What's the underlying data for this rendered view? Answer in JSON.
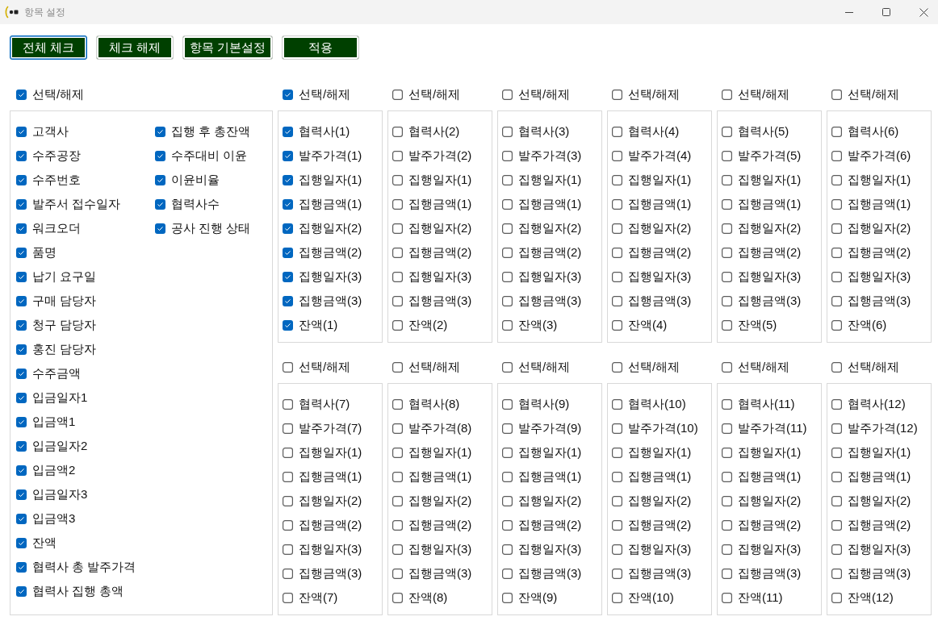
{
  "window": {
    "title": "항목 설정"
  },
  "toolbar": [
    {
      "label": "전체 체크",
      "focused": true
    },
    {
      "label": "체크 해제",
      "focused": false
    },
    {
      "label": "항목 기본설정",
      "focused": false
    },
    {
      "label": "적용",
      "focused": false
    }
  ],
  "main_group": {
    "select_all": {
      "label": "선택/해제",
      "checked": true
    },
    "columns": [
      {
        "items": [
          {
            "label": "고객사",
            "checked": true
          },
          {
            "label": "수주공장",
            "checked": true
          },
          {
            "label": "수주번호",
            "checked": true
          },
          {
            "label": "발주서 접수일자",
            "checked": true
          },
          {
            "label": "워크오더",
            "checked": true
          },
          {
            "label": "품명",
            "checked": true
          },
          {
            "label": "납기 요구일",
            "checked": true
          },
          {
            "label": "구매 담당자",
            "checked": true
          },
          {
            "label": "청구 담당자",
            "checked": true
          },
          {
            "label": "홍진 담당자",
            "checked": true
          },
          {
            "label": "수주금액",
            "checked": true
          },
          {
            "label": "입금일자1",
            "checked": true
          },
          {
            "label": "입금액1",
            "checked": true
          },
          {
            "label": "입금일자2",
            "checked": true
          },
          {
            "label": "입금액2",
            "checked": true
          },
          {
            "label": "입금일자3",
            "checked": true
          },
          {
            "label": "입금액3",
            "checked": true
          },
          {
            "label": "잔액",
            "checked": true
          },
          {
            "label": "협력사 총 발주가격",
            "checked": true
          },
          {
            "label": "협력사 집행 총액",
            "checked": true
          }
        ]
      },
      {
        "items": [
          {
            "label": "집행 후 총잔액",
            "checked": true
          },
          {
            "label": "수주대비 이윤",
            "checked": true
          },
          {
            "label": "이윤비율",
            "checked": true
          },
          {
            "label": "협력사수",
            "checked": true
          },
          {
            "label": "공사 진행 상태",
            "checked": true
          }
        ]
      }
    ]
  },
  "partner_groups": [
    {
      "select_all": {
        "label": "선택/해제",
        "checked": true
      },
      "items": [
        {
          "label": "협력사(1)",
          "checked": true
        },
        {
          "label": "발주가격(1)",
          "checked": true
        },
        {
          "label": "집행일자(1)",
          "checked": true
        },
        {
          "label": "집행금액(1)",
          "checked": true
        },
        {
          "label": "집행일자(2)",
          "checked": true
        },
        {
          "label": "집행금액(2)",
          "checked": true
        },
        {
          "label": "집행일자(3)",
          "checked": true
        },
        {
          "label": "집행금액(3)",
          "checked": true
        },
        {
          "label": "잔액(1)",
          "checked": true
        }
      ]
    },
    {
      "select_all": {
        "label": "선택/해제",
        "checked": false
      },
      "items": [
        {
          "label": "협력사(2)",
          "checked": false
        },
        {
          "label": "발주가격(2)",
          "checked": false
        },
        {
          "label": "집행일자(1)",
          "checked": false
        },
        {
          "label": "집행금액(1)",
          "checked": false
        },
        {
          "label": "집행일자(2)",
          "checked": false
        },
        {
          "label": "집행금액(2)",
          "checked": false
        },
        {
          "label": "집행일자(3)",
          "checked": false
        },
        {
          "label": "집행금액(3)",
          "checked": false
        },
        {
          "label": "잔액(2)",
          "checked": false
        }
      ]
    },
    {
      "select_all": {
        "label": "선택/해제",
        "checked": false
      },
      "items": [
        {
          "label": "협력사(3)",
          "checked": false
        },
        {
          "label": "발주가격(3)",
          "checked": false
        },
        {
          "label": "집행일자(1)",
          "checked": false
        },
        {
          "label": "집행금액(1)",
          "checked": false
        },
        {
          "label": "집행일자(2)",
          "checked": false
        },
        {
          "label": "집행금액(2)",
          "checked": false
        },
        {
          "label": "집행일자(3)",
          "checked": false
        },
        {
          "label": "집행금액(3)",
          "checked": false
        },
        {
          "label": "잔액(3)",
          "checked": false
        }
      ]
    },
    {
      "select_all": {
        "label": "선택/해제",
        "checked": false
      },
      "items": [
        {
          "label": "협력사(4)",
          "checked": false
        },
        {
          "label": "발주가격(4)",
          "checked": false
        },
        {
          "label": "집행일자(1)",
          "checked": false
        },
        {
          "label": "집행금액(1)",
          "checked": false
        },
        {
          "label": "집행일자(2)",
          "checked": false
        },
        {
          "label": "집행금액(2)",
          "checked": false
        },
        {
          "label": "집행일자(3)",
          "checked": false
        },
        {
          "label": "집행금액(3)",
          "checked": false
        },
        {
          "label": "잔액(4)",
          "checked": false
        }
      ]
    },
    {
      "select_all": {
        "label": "선택/해제",
        "checked": false
      },
      "items": [
        {
          "label": "협력사(5)",
          "checked": false
        },
        {
          "label": "발주가격(5)",
          "checked": false
        },
        {
          "label": "집행일자(1)",
          "checked": false
        },
        {
          "label": "집행금액(1)",
          "checked": false
        },
        {
          "label": "집행일자(2)",
          "checked": false
        },
        {
          "label": "집행금액(2)",
          "checked": false
        },
        {
          "label": "집행일자(3)",
          "checked": false
        },
        {
          "label": "집행금액(3)",
          "checked": false
        },
        {
          "label": "잔액(5)",
          "checked": false
        }
      ]
    },
    {
      "select_all": {
        "label": "선택/해제",
        "checked": false
      },
      "items": [
        {
          "label": "협력사(6)",
          "checked": false
        },
        {
          "label": "발주가격(6)",
          "checked": false
        },
        {
          "label": "집행일자(1)",
          "checked": false
        },
        {
          "label": "집행금액(1)",
          "checked": false
        },
        {
          "label": "집행일자(2)",
          "checked": false
        },
        {
          "label": "집행금액(2)",
          "checked": false
        },
        {
          "label": "집행일자(3)",
          "checked": false
        },
        {
          "label": "집행금액(3)",
          "checked": false
        },
        {
          "label": "잔액(6)",
          "checked": false
        }
      ]
    },
    {
      "select_all": {
        "label": "선택/해제",
        "checked": false
      },
      "items": [
        {
          "label": "협력사(7)",
          "checked": false
        },
        {
          "label": "발주가격(7)",
          "checked": false
        },
        {
          "label": "집행일자(1)",
          "checked": false
        },
        {
          "label": "집행금액(1)",
          "checked": false
        },
        {
          "label": "집행일자(2)",
          "checked": false
        },
        {
          "label": "집행금액(2)",
          "checked": false
        },
        {
          "label": "집행일자(3)",
          "checked": false
        },
        {
          "label": "집행금액(3)",
          "checked": false
        },
        {
          "label": "잔액(7)",
          "checked": false
        }
      ]
    },
    {
      "select_all": {
        "label": "선택/해제",
        "checked": false
      },
      "items": [
        {
          "label": "협력사(8)",
          "checked": false
        },
        {
          "label": "발주가격(8)",
          "checked": false
        },
        {
          "label": "집행일자(1)",
          "checked": false
        },
        {
          "label": "집행금액(1)",
          "checked": false
        },
        {
          "label": "집행일자(2)",
          "checked": false
        },
        {
          "label": "집행금액(2)",
          "checked": false
        },
        {
          "label": "집행일자(3)",
          "checked": false
        },
        {
          "label": "집행금액(3)",
          "checked": false
        },
        {
          "label": "잔액(8)",
          "checked": false
        }
      ]
    },
    {
      "select_all": {
        "label": "선택/해제",
        "checked": false
      },
      "items": [
        {
          "label": "협력사(9)",
          "checked": false
        },
        {
          "label": "발주가격(9)",
          "checked": false
        },
        {
          "label": "집행일자(1)",
          "checked": false
        },
        {
          "label": "집행금액(1)",
          "checked": false
        },
        {
          "label": "집행일자(2)",
          "checked": false
        },
        {
          "label": "집행금액(2)",
          "checked": false
        },
        {
          "label": "집행일자(3)",
          "checked": false
        },
        {
          "label": "집행금액(3)",
          "checked": false
        },
        {
          "label": "잔액(9)",
          "checked": false
        }
      ]
    },
    {
      "select_all": {
        "label": "선택/해제",
        "checked": false
      },
      "items": [
        {
          "label": "협력사(10)",
          "checked": false
        },
        {
          "label": "발주가격(10)",
          "checked": false
        },
        {
          "label": "집행일자(1)",
          "checked": false
        },
        {
          "label": "집행금액(1)",
          "checked": false
        },
        {
          "label": "집행일자(2)",
          "checked": false
        },
        {
          "label": "집행금액(2)",
          "checked": false
        },
        {
          "label": "집행일자(3)",
          "checked": false
        },
        {
          "label": "집행금액(3)",
          "checked": false
        },
        {
          "label": "잔액(10)",
          "checked": false
        }
      ]
    },
    {
      "select_all": {
        "label": "선택/해제",
        "checked": false
      },
      "items": [
        {
          "label": "협력사(11)",
          "checked": false
        },
        {
          "label": "발주가격(11)",
          "checked": false
        },
        {
          "label": "집행일자(1)",
          "checked": false
        },
        {
          "label": "집행금액(1)",
          "checked": false
        },
        {
          "label": "집행일자(2)",
          "checked": false
        },
        {
          "label": "집행금액(2)",
          "checked": false
        },
        {
          "label": "집행일자(3)",
          "checked": false
        },
        {
          "label": "집행금액(3)",
          "checked": false
        },
        {
          "label": "잔액(11)",
          "checked": false
        }
      ]
    },
    {
      "select_all": {
        "label": "선택/해제",
        "checked": false
      },
      "items": [
        {
          "label": "협력사(12)",
          "checked": false
        },
        {
          "label": "발주가격(12)",
          "checked": false
        },
        {
          "label": "집행일자(1)",
          "checked": false
        },
        {
          "label": "집행금액(1)",
          "checked": false
        },
        {
          "label": "집행일자(2)",
          "checked": false
        },
        {
          "label": "집행금액(2)",
          "checked": false
        },
        {
          "label": "집행일자(3)",
          "checked": false
        },
        {
          "label": "집행금액(3)",
          "checked": false
        },
        {
          "label": "잔액(12)",
          "checked": false
        }
      ]
    }
  ]
}
